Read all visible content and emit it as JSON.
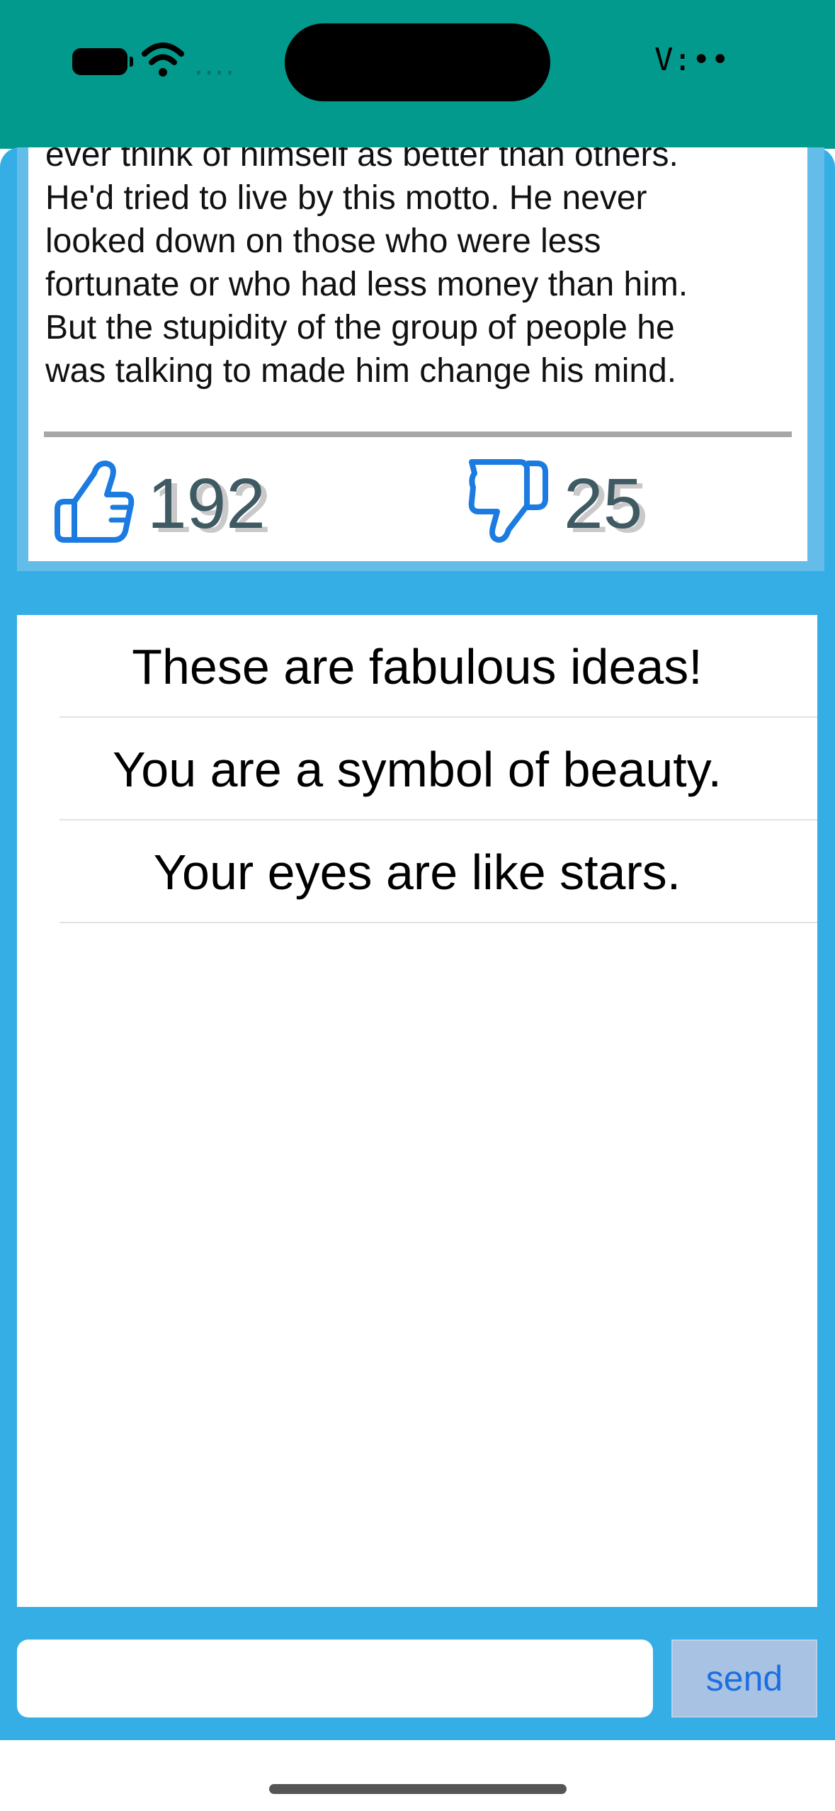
{
  "status_bar": {
    "time": "V:••",
    "signal": "....",
    "icons": [
      "battery-icon",
      "wifi-icon"
    ]
  },
  "post": {
    "text": "ever think of himself as better than others.\nHe'd tried to live by this motto. He never\nlooked down on those who were less\nfortunate or who had less money than him.\nBut the stupidity of the group of people he\nwas talking to made him change his mind.",
    "likes": "192",
    "dislikes": "25",
    "icons": [
      "thumbs-up-icon",
      "thumbs-down-icon"
    ]
  },
  "comments": [
    "These are fabulous ideas!",
    "You are a symbol of beauty.",
    "Your eyes are like stars."
  ],
  "composer": {
    "input_value": "",
    "send_label": "send"
  },
  "colors": {
    "status_bar": "#019a8c",
    "background": "#35ade5",
    "accent": "#1c7be0",
    "count_text": "#3f5a63"
  }
}
